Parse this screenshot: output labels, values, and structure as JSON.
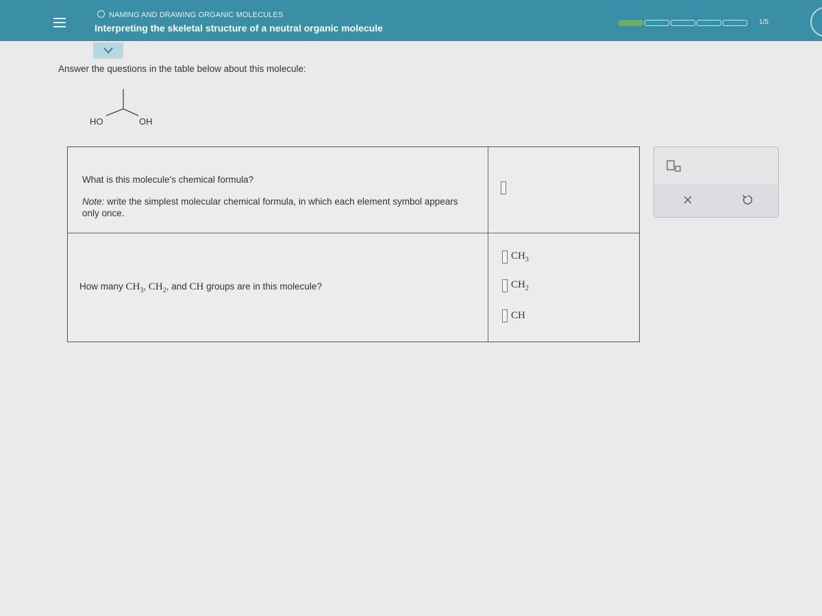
{
  "header": {
    "topic": "NAMING AND DRAWING ORGANIC MOLECULES",
    "title": "Interpreting the skeletal structure of a neutral organic molecule",
    "progress_label": "1/5",
    "progress": {
      "completed": 1,
      "total": 5
    }
  },
  "instructions": "Answer the questions in the table below about this molecule:",
  "molecule": {
    "left_label": "HO",
    "right_label": "OH"
  },
  "questions": {
    "q1": {
      "text": "What is this molecule's chemical formula?",
      "note_label": "Note:",
      "note_text": " write the simplest molecular chemical formula, in which each element symbol appears only once.",
      "answer": ""
    },
    "q2": {
      "prefix": "How many ",
      "ch3": "CH",
      "ch3_sub": "3",
      "sep1": ", ",
      "ch2": "CH",
      "ch2_sub": "2",
      "sep2": ", and ",
      "ch": "CH",
      "suffix": " groups are in this molecule?",
      "answers": {
        "ch3_label": "CH",
        "ch3_label_sub": "3",
        "ch2_label": "CH",
        "ch2_label_sub": "2",
        "ch_label": "CH"
      }
    }
  },
  "toolbox": {
    "tools": [
      "subscript-icon",
      "close-icon",
      "undo-icon"
    ]
  },
  "colors": {
    "header_bg": "#3a8fa6",
    "progress_done": "#6fae5e",
    "page_bg": "#e9eaec"
  }
}
